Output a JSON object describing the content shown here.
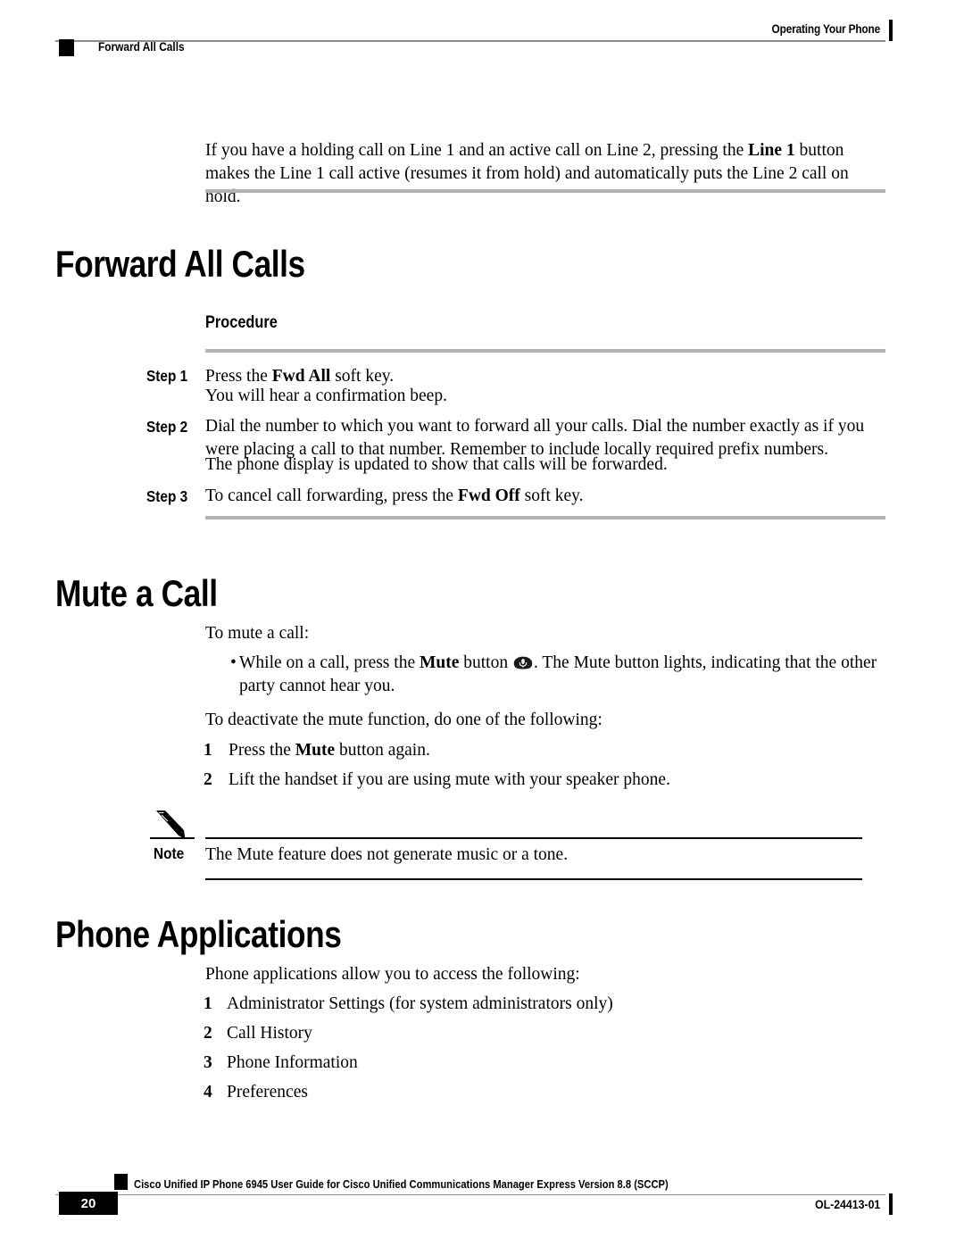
{
  "header": {
    "running_title": "Operating Your Phone",
    "section_title": "Forward All Calls"
  },
  "body": {
    "intro_paragraph_html": "If you have a holding call on Line 1 and an active call on Line 2, pressing the  <b>Line 1</b> button makes the Line 1 call active (resumes it from hold) and automatically puts the Line 2 call on hold."
  },
  "forward_all_calls": {
    "heading": "Forward All Calls",
    "procedure_label": "Procedure",
    "steps": [
      {
        "label": "Step 1",
        "lines_html": [
          "Press the <b>Fwd All</b>  soft key.",
          "You will hear a confirmation beep."
        ]
      },
      {
        "label": "Step 2",
        "lines_html": [
          "Dial the number to which you want to forward all your calls. Dial the number exactly as if you were placing a call to that number. Remember to include locally required prefix numbers.",
          "The phone display is updated to show that calls will be forwarded."
        ]
      },
      {
        "label": "Step 3",
        "lines_html": [
          "To cancel call forwarding, press the <b>Fwd Off</b> soft key."
        ]
      }
    ]
  },
  "mute_a_call": {
    "heading": "Mute a Call",
    "intro": "To mute a call:",
    "bullet_marker": "•",
    "bullet_html_before_icon": "While on a call, press the <b>Mute</b> button ",
    "bullet_icon_name": "mute-button-icon",
    "bullet_html_after_icon": ". The Mute button lights, indicating that the other party cannot hear you.",
    "deactivate_intro": "To deactivate the mute function, do one of the following:",
    "deactivate_items": [
      {
        "number": "1",
        "text_html": "Press the <b>Mute</b> button again."
      },
      {
        "number": "2",
        "text_html": "Lift the handset if you are using mute with your speaker phone."
      }
    ],
    "note": {
      "icon_name": "pencil-icon",
      "label": "Note",
      "text": "The Mute feature does not generate music or a tone."
    }
  },
  "phone_applications": {
    "heading": "Phone Applications",
    "intro": "Phone applications allow you to access the following:",
    "items": [
      {
        "number": "1",
        "text": "Administrator Settings (for system administrators only)"
      },
      {
        "number": "2",
        "text": "Call History"
      },
      {
        "number": "3",
        "text": "Phone Information"
      },
      {
        "number": "4",
        "text": "Preferences"
      }
    ]
  },
  "footer": {
    "page_number": "20",
    "guide_title": "Cisco Unified IP Phone 6945 User Guide for Cisco Unified Communications Manager Express Version 8.8 (SCCP)",
    "document_id": "OL-24413-01"
  },
  "colors": {
    "rule_gray": "#b3b3b3",
    "thin_rule_gray": "#8d8d8d",
    "text": "#000000",
    "background": "#ffffff"
  }
}
